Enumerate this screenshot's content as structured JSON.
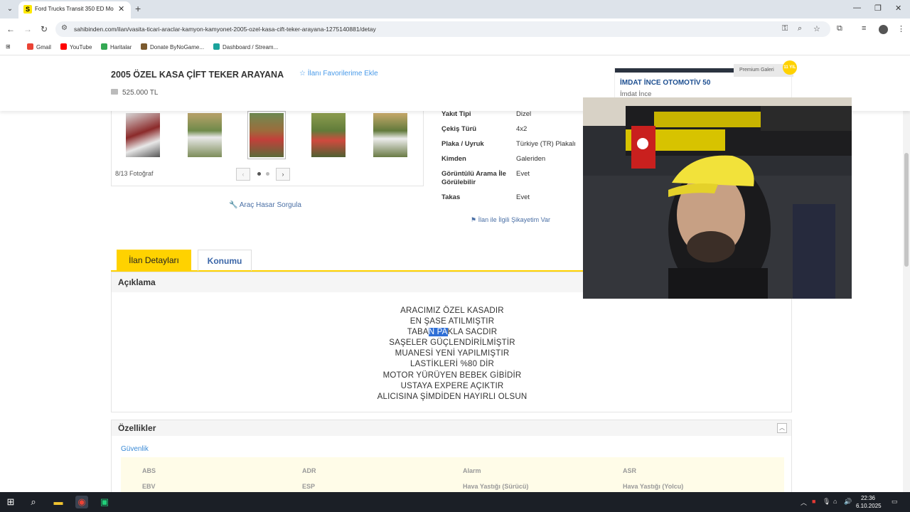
{
  "browser": {
    "tab_title": "Ford Trucks Transit 350 ED Mo",
    "tab_favicon": "S",
    "url": "sahibinden.com/ilan/vasita-ticari-araclar-kamyon-kamyonet-2005-ozel-kasa-cift-teker-arayana-1275140881/detay",
    "bookmarks": [
      "Gmail",
      "YouTube",
      "Haritalar",
      "Donate ByNoGame...",
      "Dashboard / Stream..."
    ]
  },
  "listing": {
    "title": "2005 ÖZEL KASA ÇİFT TEKER ARAYANA",
    "favorite_label": "İlanı Favorilerime Ekle",
    "price": "525.000 TL",
    "photo_count": "8/13 Fotoğraf",
    "damage_query_label": "Araç Hasar Sorgula",
    "complaint_label": "İlan ile İlgili Şikayetim Var"
  },
  "dealer": {
    "premium_label": "Premium Galeri",
    "badge": "11 YIL",
    "name": "İMDAT İNCE OTOMOTİV 50",
    "person": "İmdat İnce"
  },
  "specs": [
    {
      "key": "Yakıt Tipi",
      "value": "Dizel"
    },
    {
      "key": "Çekiş Türü",
      "value": "4x2"
    },
    {
      "key": "Plaka / Uyruk",
      "value": "Türkiye (TR) Plakalı"
    },
    {
      "key": "Kimden",
      "value": "Galeriden"
    },
    {
      "key": "Görüntülü Arama İle Görülebilir",
      "value": "Evet"
    },
    {
      "key": "Takas",
      "value": "Evet"
    }
  ],
  "tabs": {
    "details": "İlan Detayları",
    "location": "Konumu"
  },
  "description": {
    "heading": "Açıklama",
    "line1": "ARACIMIZ ÖZEL KASADIR",
    "line2": "EN ŞASE ATILMIŞTIR",
    "line3_a": "TABA",
    "line3_sel": "N PA",
    "line3_b": "KLA SACDIR",
    "line4": "SAŞELER GÜÇLENDİRİLMİŞTİR",
    "line5": "MUANESİ YENİ YAPILMIŞTIR",
    "line6": "LASTİKLERİ %80 DİR",
    "line7": "MOTOR YÜRÜYEN BEBEK GİBİDİR",
    "line8": "USTAYA EXPERE AÇIKTIR",
    "line9": "ALICISINA ŞİMDİDEN HAYIRLI OLSUN"
  },
  "features": {
    "heading": "Özellikler",
    "category": "Güvenlik",
    "items": [
      "ABS",
      "ADR",
      "Alarm",
      "ASR",
      "EBV",
      "ESP",
      "Hava Yastığı (Sürücü)",
      "Hava Yastığı (Yolcu)"
    ]
  },
  "taskbar": {
    "time": "22:36",
    "date": "6.10.2025"
  },
  "colors": {
    "accent": "#ffd200",
    "link": "#489ae9",
    "selection": "#2f6fd6"
  }
}
